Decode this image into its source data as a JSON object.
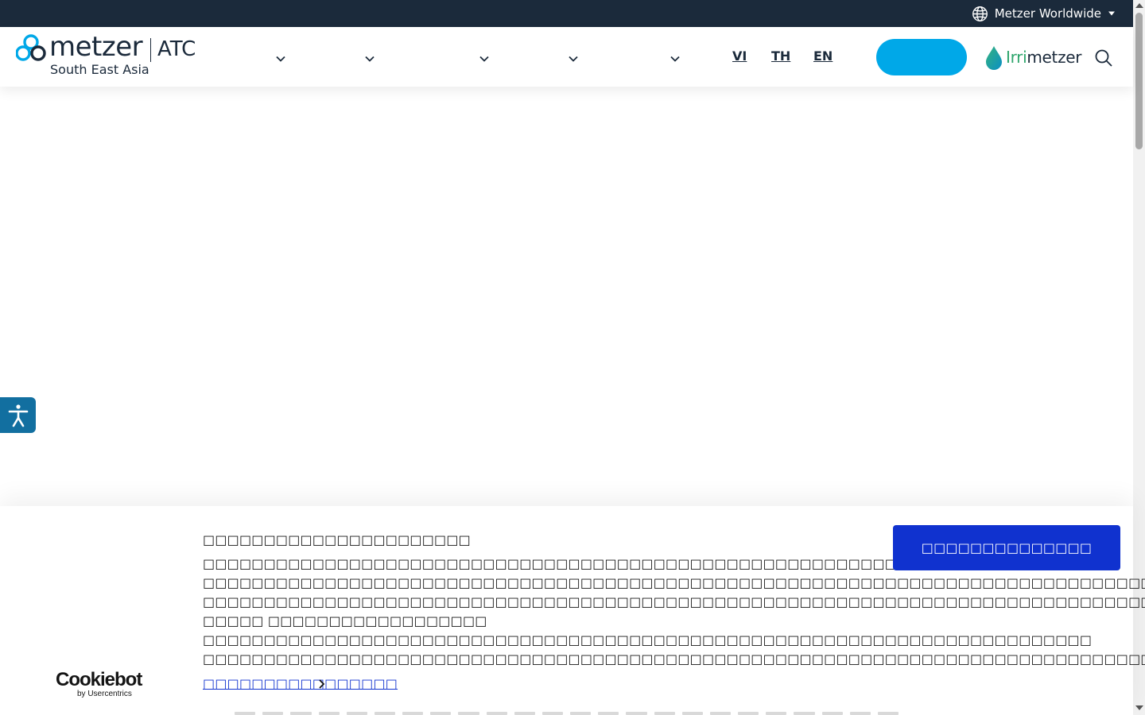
{
  "topbar": {
    "worldwide_label": "Metzer Worldwide"
  },
  "header": {
    "logo": {
      "word": "metzer",
      "suffix": "ATC",
      "region": "South East Asia"
    },
    "languages": [
      "VI",
      "TH",
      "EN"
    ],
    "partner_logo": {
      "prefix": "Irri",
      "word": "metzer"
    }
  },
  "cookie_banner": {
    "title": "□□□□□□□□□□□□□□□□□□□□□□",
    "body": "□□□□□□□□□□□□□□□□□□□□□□□□□□□□□□□□□□□□□□□□□□□□□□□□□□□□□□□□□□□□ □□□□□□□□□□□□□□□□□□□□□□□□□□□□□□□□□□□□□□□□□□□□□□□□□□□□□□□□□□□□□□□□□□□□□□□□□□□□□□□□□□□□□□□□ □□□□□□□□□□□□□□□□□□□□□□□□□□□□□□□□□□□□□□□□□□□□□□□□□□□□□□□□□□□□□□□□□□□□□□□□□□□□□□□□□□□□□□□□□□□□□□□□□□ □□□□□ □□□□□□□□□□□□□□□□□□ □□□□□□□□□□□□□□□□□□□□□□□□□□□□□□□□□□□□□□□□□□□□□□□□□□□□□□□□□□□□□□□□□□□□□□□□□ □□□□□□□□□□□□□□□□□□□□□□□□□□□□□□□□□□□□□□□□□□□□□□□□□□□□□□□□□□□□□□□□□□□□□□□□□□□□□□□□□□□□□□□□□□□□□□□□□□□□□□□□□□□",
    "allow_button": "□□□□□□□□□□□□□□",
    "details_link": "□□□□□□□□□□□□□□□□",
    "brand_main": "Cookiebot",
    "brand_sub": "by Usercentrics"
  },
  "icons": {
    "globe": "globe-icon",
    "dropdown": "caret-down-icon",
    "nav": "chevron-down-icon",
    "search": "search-icon",
    "accessibility": "accessibility-icon"
  },
  "colors": {
    "topbar": "#1b2a3b",
    "cta": "#00a8e8",
    "allow_button": "#1032cf",
    "accessibility": "#126fa0",
    "logo_circles": "#00a8e8"
  }
}
